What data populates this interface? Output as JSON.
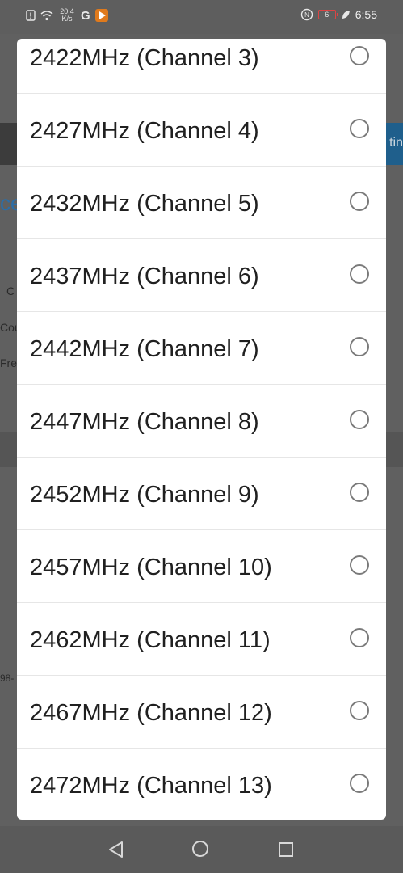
{
  "status_bar": {
    "network_speed_value": "20.4",
    "network_speed_unit": "K/s",
    "g_label": "G",
    "battery_level": "6",
    "time": "6:55"
  },
  "background": {
    "tab_fragment": "tin",
    "heading_fragment": "ce",
    "field1_fragment": "C",
    "field2_fragment": "Cou",
    "field3_fragment": "Fre",
    "footer_fragment": "98-"
  },
  "channel_options": [
    {
      "label": "2422MHz (Channel 3)",
      "selected": false
    },
    {
      "label": "2427MHz (Channel 4)",
      "selected": false
    },
    {
      "label": "2432MHz (Channel 5)",
      "selected": false
    },
    {
      "label": "2437MHz (Channel 6)",
      "selected": false
    },
    {
      "label": "2442MHz (Channel 7)",
      "selected": false
    },
    {
      "label": "2447MHz (Channel 8)",
      "selected": false
    },
    {
      "label": "2452MHz (Channel 9)",
      "selected": false
    },
    {
      "label": "2457MHz (Channel 10)",
      "selected": false
    },
    {
      "label": "2462MHz (Channel 11)",
      "selected": false
    },
    {
      "label": "2467MHz (Channel 12)",
      "selected": false
    },
    {
      "label": "2472MHz (Channel 13)",
      "selected": false
    }
  ],
  "icons": {
    "back": "back-triangle-icon",
    "home": "home-circle-icon",
    "recent": "recent-apps-square-icon"
  }
}
